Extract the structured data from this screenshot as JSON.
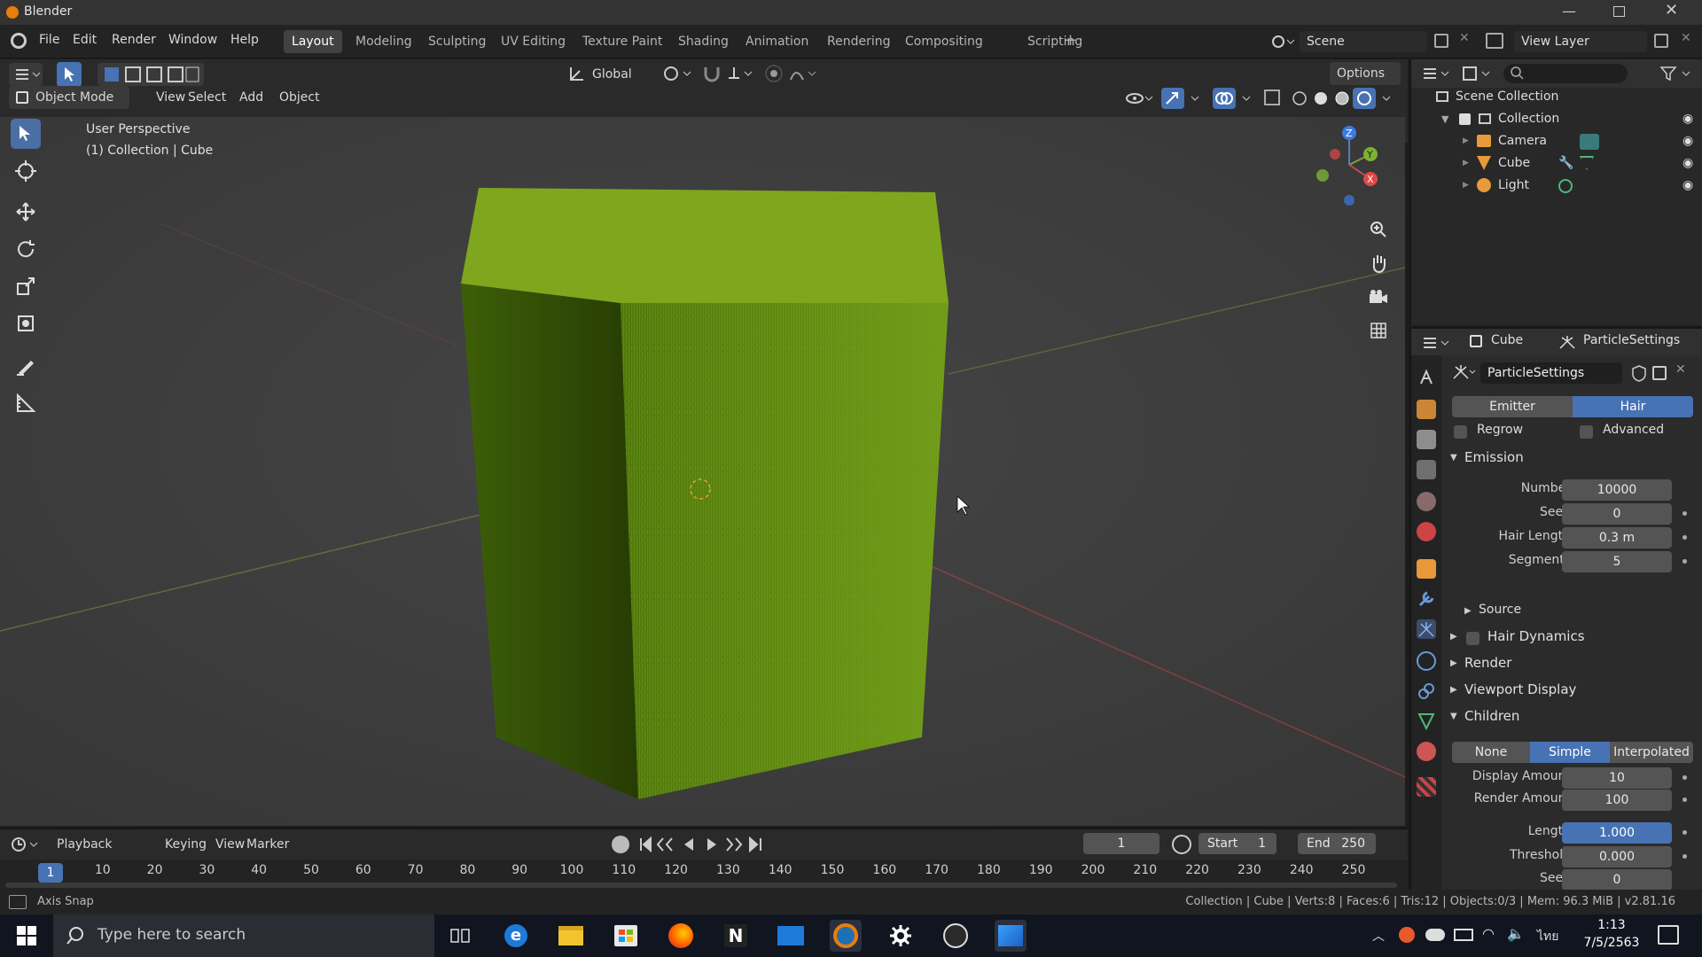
{
  "window": {
    "title": "Blender"
  },
  "menus": [
    "File",
    "Edit",
    "Render",
    "Window",
    "Help"
  ],
  "workspaces": [
    "Layout",
    "Modeling",
    "Sculpting",
    "UV Editing",
    "Texture Paint",
    "Shading",
    "Animation",
    "Rendering",
    "Compositing",
    "Scripting"
  ],
  "active_workspace": "Layout",
  "scene": {
    "name": "Scene",
    "view_layer": "View Layer"
  },
  "viewport_header": {
    "orientation": "Global",
    "options": "Options",
    "mode": "Object Mode",
    "menus": [
      "View",
      "Select",
      "Add",
      "Object"
    ]
  },
  "viewport": {
    "perspective": "User Perspective",
    "collection_info": "(1) Collection | Cube",
    "gizmo_labels": {
      "z": "Z",
      "y": "Y",
      "x": "X"
    }
  },
  "outliner": {
    "root": "Scene Collection",
    "collection": "Collection",
    "items": [
      "Camera",
      "Cube",
      "Light"
    ]
  },
  "properties": {
    "object": "Cube",
    "context": "ParticleSettings",
    "settings_name": "ParticleSettings",
    "type_options": [
      "Emitter",
      "Hair"
    ],
    "active_type": "Hair",
    "regrow": "Regrow",
    "advanced": "Advanced",
    "emission": {
      "header": "Emission",
      "number_label": "Number",
      "number": "10000",
      "seed_label": "Seed",
      "seed": "0",
      "hair_length_label": "Hair Length",
      "hair_length": "0.3 m",
      "segments_label": "Segments",
      "segments": "5"
    },
    "subpanels": {
      "source": "Source",
      "hair_dynamics": "Hair Dynamics",
      "render": "Render",
      "viewport_display": "Viewport Display"
    },
    "children": {
      "header": "Children",
      "modes": [
        "None",
        "Simple",
        "Interpolated"
      ],
      "active_mode": "Simple",
      "display_amount_label": "Display Amount",
      "display_amount": "10",
      "render_amount_label": "Render Amount",
      "render_amount": "100",
      "length_label": "Length",
      "length": "1.000",
      "threshold_label": "Threshold",
      "threshold": "0.000",
      "seed_label": "Seed",
      "seed": "0"
    }
  },
  "timeline": {
    "menus": [
      "Playback",
      "Keying",
      "View",
      "Marker"
    ],
    "current_frame": "1",
    "start_label": "Start",
    "start": "1",
    "end_label": "End",
    "end": "250",
    "ticks": [
      "1",
      "10",
      "20",
      "30",
      "40",
      "50",
      "60",
      "70",
      "80",
      "90",
      "100",
      "110",
      "120",
      "130",
      "140",
      "150",
      "160",
      "170",
      "180",
      "190",
      "200",
      "210",
      "220",
      "230",
      "240",
      "250"
    ]
  },
  "statusbar": {
    "left": "Axis Snap",
    "right": "Collection | Cube | Verts:8 | Faces:6 | Tris:12 | Objects:0/3 | Mem: 96.3 MiB | v2.81.16"
  },
  "taskbar": {
    "search_placeholder": "Type here to search",
    "time": "1:13",
    "date": "7/5/2563",
    "lang": "ไทย"
  },
  "colors": {
    "accent": "#4772b3",
    "grass": "#6a9a14",
    "grass_dark": "#3b5a08",
    "background": "#3d3d3d"
  }
}
